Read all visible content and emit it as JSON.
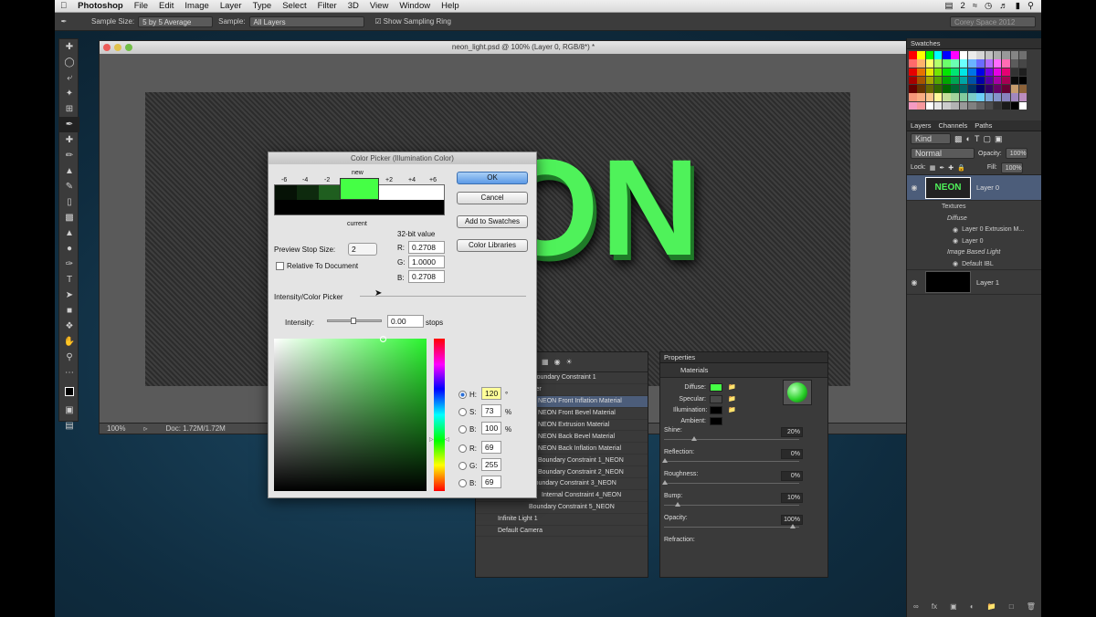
{
  "menubar": {
    "app": "Photoshop",
    "items": [
      "File",
      "Edit",
      "Image",
      "Layer",
      "Type",
      "Select",
      "Filter",
      "3D",
      "View",
      "Window",
      "Help"
    ],
    "status": {
      "badge": "2",
      "workspace": "Corey Space 2012"
    }
  },
  "options": {
    "sample_size_label": "Sample Size:",
    "sample_size_value": "5 by 5 Average",
    "sample_label": "Sample:",
    "sample_value": "All Layers",
    "ring_label": "Show Sampling Ring"
  },
  "document": {
    "title": "neon_light.psd @ 100% (Layer 0, RGB/8*) *",
    "canvas_text": "ON",
    "zoom": "100%",
    "doc_info": "Doc: 1.72M/1.72M"
  },
  "swatches": {
    "tab": "Swatches",
    "colors": [
      "#ff0000",
      "#ffff00",
      "#00ff00",
      "#00ffff",
      "#0000ff",
      "#ff00ff",
      "#ffffff",
      "#ebebeb",
      "#d6d6d6",
      "#c2c2c2",
      "#adadad",
      "#999999",
      "#858585",
      "#707070",
      "#ff6b6b",
      "#ffb36b",
      "#ffff6b",
      "#b3ff6b",
      "#6bff6b",
      "#6bffb3",
      "#6bffff",
      "#6bb3ff",
      "#6b6bff",
      "#b36bff",
      "#ff6bff",
      "#ff6bb3",
      "#5c5c5c",
      "#474747",
      "#e60000",
      "#e67300",
      "#e6e600",
      "#73e600",
      "#00e600",
      "#00e673",
      "#00e6e6",
      "#0073e6",
      "#0000e6",
      "#7300e6",
      "#e600e6",
      "#e60073",
      "#333333",
      "#1f1f1f",
      "#a60000",
      "#a65300",
      "#a6a600",
      "#53a600",
      "#00a600",
      "#00a653",
      "#00a6a6",
      "#0053a6",
      "#0000a6",
      "#5300a6",
      "#a600a6",
      "#a60053",
      "#0a0a0a",
      "#000000",
      "#660000",
      "#663300",
      "#666600",
      "#336600",
      "#006600",
      "#006633",
      "#006666",
      "#003366",
      "#000066",
      "#330066",
      "#660066",
      "#660033",
      "#c69c6d",
      "#8c6239",
      "#f7977a",
      "#fbad82",
      "#fdc68c",
      "#fff799",
      "#c4df9b",
      "#a3d39c",
      "#82ca9d",
      "#7bcdc8",
      "#6ecff6",
      "#7ea7d8",
      "#8493ca",
      "#8882be",
      "#a187be",
      "#bc8dbf",
      "#f49ac2",
      "#f6989d",
      "#ffffff",
      "#e6e6e6",
      "#cccccc",
      "#b3b3b3",
      "#999999",
      "#808080",
      "#666666",
      "#4d4d4d",
      "#333333",
      "#1a1a1a",
      "#000000",
      "#ffffff"
    ]
  },
  "layers": {
    "tabs": [
      "Layers",
      "Channels",
      "Paths"
    ],
    "kind": "Kind",
    "blend": "Normal",
    "opacity_label": "Opacity:",
    "opacity": "100%",
    "lock_label": "Lock:",
    "fill_label": "Fill:",
    "fill": "100%",
    "layer0_thumb": "NEON",
    "layer0_name": "Layer 0",
    "textures": "Textures",
    "diffuse": "Diffuse",
    "extrusion": "Layer 0 Extrusion M...",
    "layer0_sub": "Layer 0",
    "ibl": "Image Based Light",
    "default_ibl": "Default IBL",
    "layer1_name": "Layer 1"
  },
  "scene3d": {
    "rows": [
      "Boundary Constraint 1",
      "yer",
      "NEON Front Inflation Material",
      "NEON Front Bevel Material",
      "NEON Extrusion Material",
      "NEON Back Bevel Material",
      "NEON Back Inflation Material",
      "Boundary Constraint 1_NEON",
      "Boundary Constraint 2_NEON",
      "Boundary Constraint 3_NEON",
      "Internal Constraint 4_NEON",
      "Boundary Constraint 5_NEON",
      "Infinite Light 1",
      "Default Camera"
    ]
  },
  "properties": {
    "tab": "Properties",
    "section": "Materials",
    "diffuse": "Diffuse:",
    "specular": "Specular:",
    "illumination": "Illumination:",
    "ambient": "Ambient:",
    "shine": "Shine:",
    "shine_val": "20%",
    "reflection": "Reflection:",
    "reflection_val": "0%",
    "roughness": "Roughness:",
    "roughness_val": "0%",
    "bump": "Bump:",
    "bump_val": "10%",
    "opacity": "Opacity:",
    "opacity_val": "100%",
    "refraction": "Refraction:"
  },
  "picker": {
    "title": "Color Picker (Illumination Color)",
    "stops": [
      "-6",
      "-4",
      "-2",
      "+2",
      "+4",
      "+6"
    ],
    "new_label": "new",
    "current_label": "current",
    "ok": "OK",
    "cancel": "Cancel",
    "add": "Add to Swatches",
    "libraries": "Color Libraries",
    "bit_label": "32-bit value",
    "r_label": "R:",
    "r_val": "0.2708",
    "g_label": "G:",
    "g_val": "1.0000",
    "b_label": "B:",
    "b_val": "0.2708",
    "preview_label": "Preview Stop Size:",
    "preview_val": "2",
    "relative_label": "Relative To Document",
    "section": "Intensity/Color Picker",
    "intensity_label": "Intensity:",
    "intensity_val": "0.00",
    "intensity_unit": "stops",
    "h_label": "H:",
    "h_val": "120",
    "h_unit": "°",
    "s_label": "S:",
    "s_val": "73",
    "s_unit": "%",
    "bb_label": "B:",
    "bb_val": "100",
    "bb_unit": "%",
    "rr_label": "R:",
    "rr_val": "69",
    "gg_label": "G:",
    "gg_val": "255",
    "b2_label": "B:",
    "b2_val": "69",
    "new_color": "#45ff45"
  }
}
